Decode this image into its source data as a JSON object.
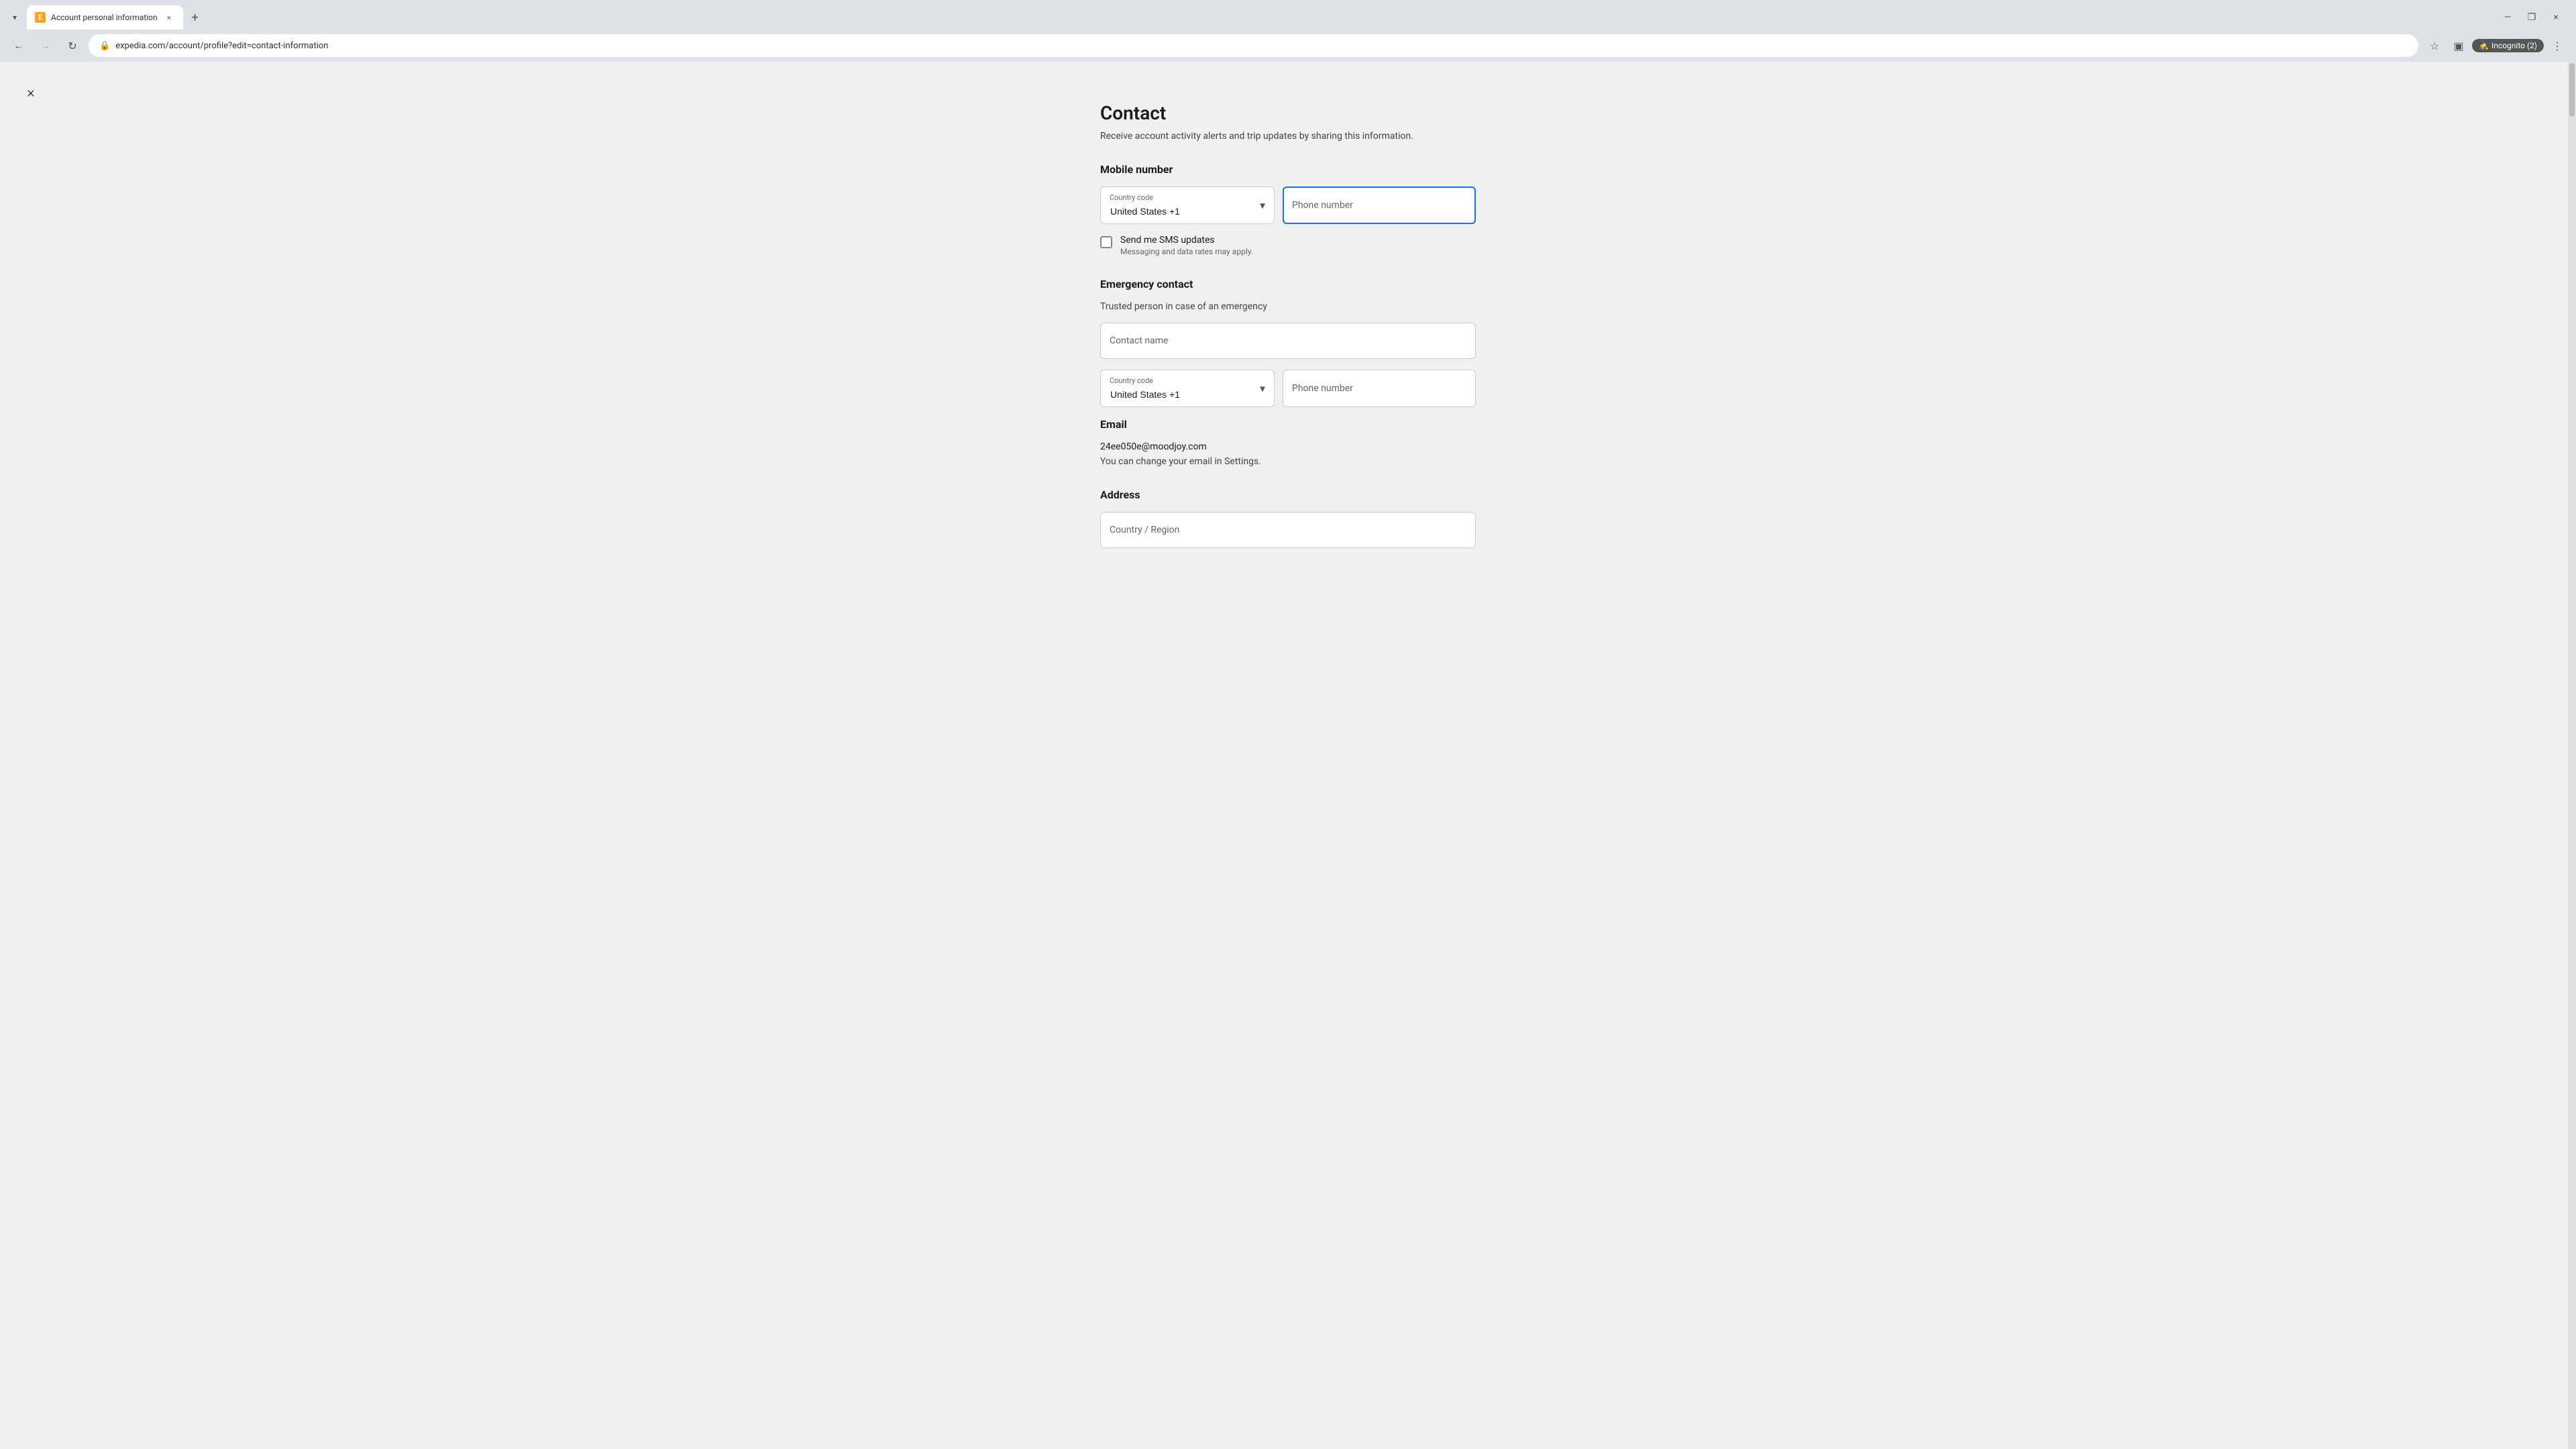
{
  "browser": {
    "tab": {
      "favicon_text": "E",
      "title": "Account personal information",
      "close_icon": "×"
    },
    "new_tab_icon": "+",
    "window_controls": {
      "minimize": "—",
      "maximize": "❐",
      "close": "×"
    },
    "nav": {
      "back_icon": "←",
      "forward_icon": "→",
      "refresh_icon": "↻",
      "url": "expedia.com/account/profile?edit=contact-information",
      "bookmark_icon": "☆",
      "sidebar_icon": "▣",
      "incognito_label": "Incognito (2)",
      "more_icon": "⋮"
    }
  },
  "page": {
    "close_icon": "×",
    "title": "Contact",
    "subtitle": "Receive account activity alerts and trip updates by sharing this information.",
    "mobile_number": {
      "section_label": "Mobile number",
      "country_code_label": "Country code",
      "country_code_value": "United States +1",
      "phone_number_label": "Phone number",
      "phone_number_placeholder": "Phone number",
      "sms_checkbox_label": "Send me SMS updates",
      "sms_checkbox_sublabel": "Messaging and data rates may apply."
    },
    "emergency_contact": {
      "section_label": "Emergency contact",
      "section_desc": "Trusted person in case of an emergency",
      "contact_name_placeholder": "Contact name",
      "country_code_label": "Country code",
      "country_code_value": "United States +1",
      "phone_number_label": "Phone number",
      "phone_number_placeholder": "Phone number"
    },
    "email": {
      "section_label": "Email",
      "email_value": "24ee050e@moodjoy.com",
      "change_note": "You can change your email in Settings."
    },
    "address": {
      "section_label": "Address",
      "country_placeholder": "Country / Region"
    }
  }
}
